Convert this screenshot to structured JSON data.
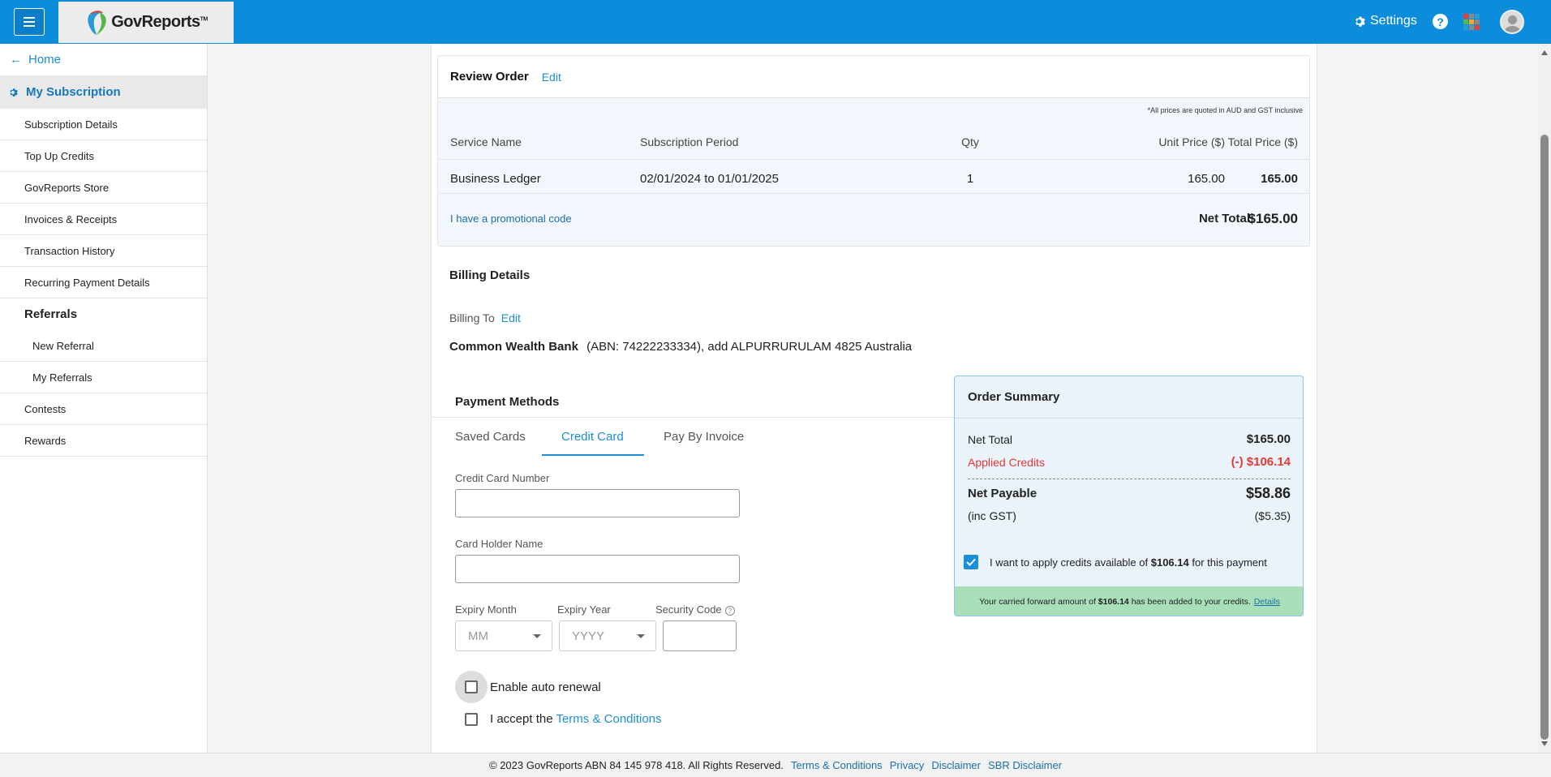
{
  "header": {
    "logo_text": "GovReports",
    "logo_tm": "TM",
    "settings_label": "Settings",
    "help_glyph": "?",
    "brand_color": "#0c8ddc"
  },
  "sidebar": {
    "home_label": "Home",
    "section_label": "My Subscription",
    "items": [
      {
        "label": "Subscription Details"
      },
      {
        "label": "Top Up Credits"
      },
      {
        "label": "GovReports Store"
      },
      {
        "label": "Invoices & Receipts"
      },
      {
        "label": "Transaction History"
      },
      {
        "label": "Recurring Payment Details"
      }
    ],
    "referrals_label": "Referrals",
    "referral_items": [
      {
        "label": "New Referral"
      },
      {
        "label": "My Referrals"
      }
    ],
    "bottom_items": [
      {
        "label": "Contests"
      },
      {
        "label": "Rewards"
      }
    ]
  },
  "review": {
    "title": "Review Order",
    "edit_label": "Edit",
    "price_note": "*All prices are quoted in AUD and GST inclusive",
    "columns": {
      "service": "Service Name",
      "period": "Subscription Period",
      "qty": "Qty",
      "unit": "Unit Price ($)",
      "total": "Total Price ($)"
    },
    "row": {
      "service": "Business Ledger",
      "period": "02/01/2024 to 01/01/2025",
      "qty": "1",
      "unit": "165.00",
      "total": "165.00"
    },
    "promo_label": "I have a promotional code",
    "net_total_label": "Net Total:",
    "net_total_value": "$165.00"
  },
  "billing": {
    "title": "Billing Details",
    "billing_to_label": "Billing To",
    "edit_label": "Edit",
    "company": "Common Wealth Bank",
    "details": "(ABN: 74222233334),  add ALPURRURULAM 4825 Australia"
  },
  "payment": {
    "title": "Payment Methods",
    "tabs": [
      {
        "label": "Saved Cards"
      },
      {
        "label": "Credit Card"
      },
      {
        "label": "Pay By Invoice"
      }
    ],
    "active_tab": "Credit Card",
    "card_number_label": "Credit Card Number",
    "card_number_value": "",
    "holder_label": "Card Holder Name",
    "holder_value": "",
    "expiry_month_label": "Expiry Month",
    "expiry_month_value": "MM",
    "expiry_year_label": "Expiry Year",
    "expiry_year_value": "YYYY",
    "security_label": "Security Code",
    "security_value": "",
    "auto_renewal_label": "Enable auto renewal",
    "accept_label": "I accept the",
    "terms_link": "Terms & Conditions"
  },
  "summary": {
    "title": "Order Summary",
    "net_total_label": "Net Total",
    "net_total_value": "$165.00",
    "applied_label": "Applied Credits",
    "applied_value": "(-) $106.14",
    "payable_label": "Net Payable",
    "payable_value": "$58.86",
    "gst_label": "(inc GST)",
    "gst_value": "($5.35)",
    "apply_text_pre": "I want to apply credits available of",
    "apply_amount": "$106.14",
    "apply_text_post": "for this payment",
    "footer_pre": "Your carried forward amount of",
    "footer_amount": "$106.14",
    "footer_post": "has been added to your credits.",
    "footer_link": "Details",
    "accent_color": "#1b8ed9",
    "credit_color": "#e53935"
  },
  "footer": {
    "copyright": "© 2023 GovReports ABN 84 145 978 418. All Rights Reserved.",
    "links": [
      {
        "label": "Terms & Conditions"
      },
      {
        "label": "Privacy"
      },
      {
        "label": "Disclaimer"
      },
      {
        "label": "SBR Disclaimer"
      }
    ]
  }
}
